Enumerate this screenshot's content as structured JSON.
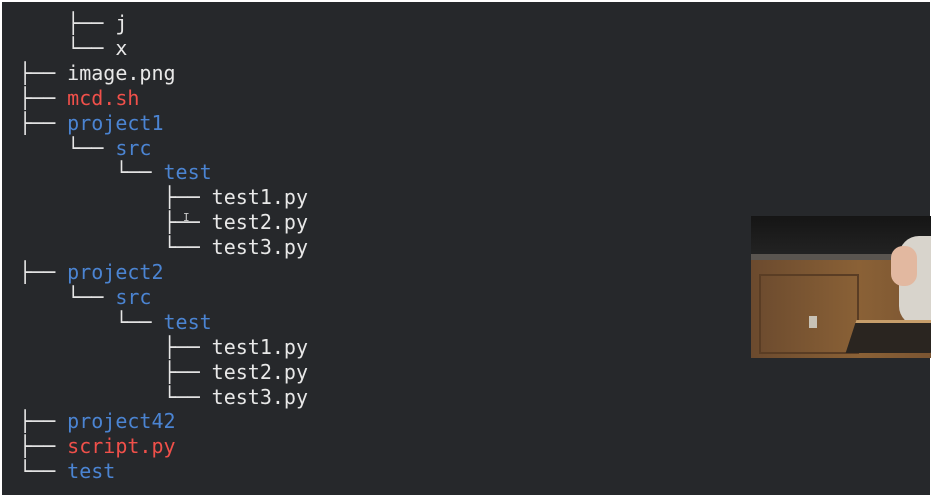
{
  "terminal": {
    "tree": [
      {
        "prefix": "    ├── ",
        "name": "j",
        "kind": "file"
      },
      {
        "prefix": "    └── ",
        "name": "x",
        "kind": "file"
      },
      {
        "prefix": "├── ",
        "name": "image.png",
        "kind": "file"
      },
      {
        "prefix": "├── ",
        "name": "mcd.sh",
        "kind": "exec"
      },
      {
        "prefix": "├── ",
        "name": "project1",
        "kind": "dir"
      },
      {
        "prefix": "    └── ",
        "name": "src",
        "kind": "dir"
      },
      {
        "prefix": "        └── ",
        "name": "test",
        "kind": "dir"
      },
      {
        "prefix": "            ├── ",
        "name": "test1.py",
        "kind": "file"
      },
      {
        "prefix": "            ├── ",
        "name": "test2.py",
        "kind": "file"
      },
      {
        "prefix": "            └── ",
        "name": "test3.py",
        "kind": "file"
      },
      {
        "prefix": "├── ",
        "name": "project2",
        "kind": "dir"
      },
      {
        "prefix": "    └── ",
        "name": "src",
        "kind": "dir"
      },
      {
        "prefix": "        └── ",
        "name": "test",
        "kind": "dir"
      },
      {
        "prefix": "            ├── ",
        "name": "test1.py",
        "kind": "file"
      },
      {
        "prefix": "            ├── ",
        "name": "test2.py",
        "kind": "file"
      },
      {
        "prefix": "            └── ",
        "name": "test3.py",
        "kind": "file"
      },
      {
        "prefix": "├── ",
        "name": "project42",
        "kind": "dir"
      },
      {
        "prefix": "├── ",
        "name": "script.py",
        "kind": "exec"
      },
      {
        "prefix": "└── ",
        "name": "test",
        "kind": "dir"
      }
    ],
    "cursor_glyph": "I"
  },
  "colors": {
    "background": "#26282b",
    "file": "#e8e8e8",
    "directory": "#4b84d2",
    "executable": "#f0504a"
  }
}
